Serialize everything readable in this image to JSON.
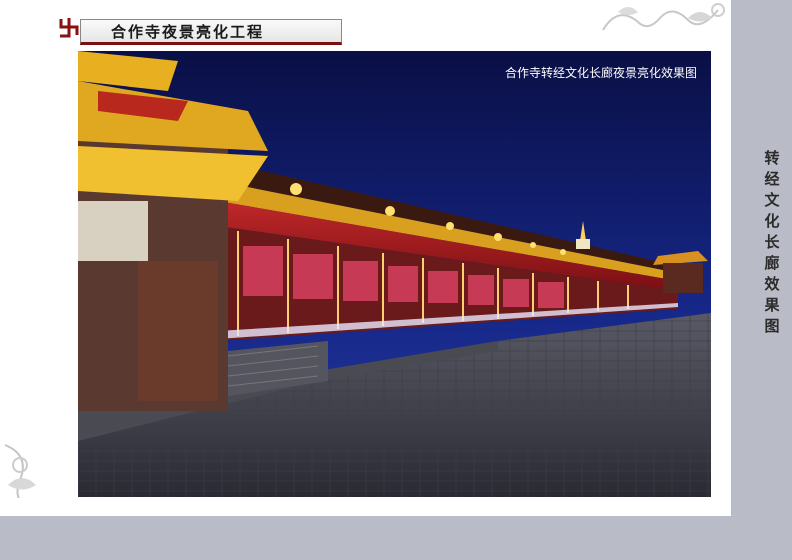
{
  "header": {
    "title": "合作寺夜景亮化工程"
  },
  "photo": {
    "caption": "合作寺转经文化长廊夜景亮化效果图"
  },
  "side": {
    "vertical_title": "转经文化长廊效果图"
  },
  "colors": {
    "accent_red": "#7a1010",
    "side_band": "#b9bbc6",
    "sky": "#0d1550"
  },
  "icons": {
    "logo": "swastika-logo-icon"
  }
}
